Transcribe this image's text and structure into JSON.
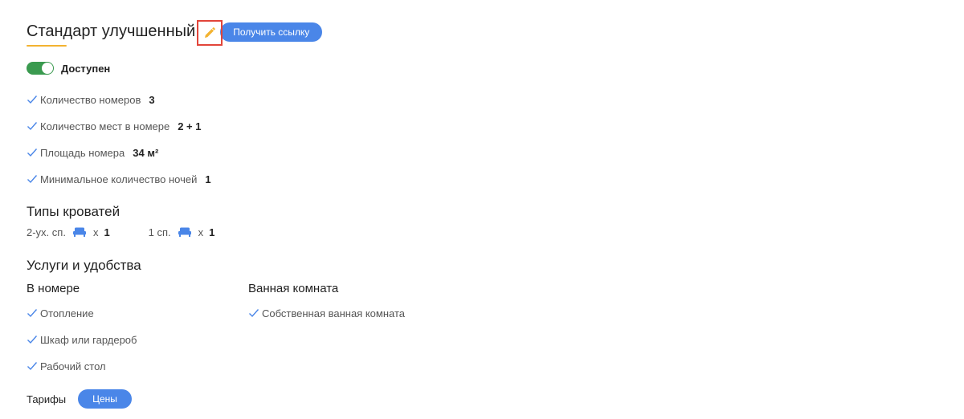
{
  "room": {
    "title": "Стандарт улучшенный",
    "get_link_label": "Получить ссылку",
    "accent_color": "#f3b331",
    "edit_icon": "pencil-icon"
  },
  "availability": {
    "label": "Доступен",
    "enabled": true,
    "toggle_color": "#3a9a4f"
  },
  "features": [
    {
      "label": "Количество номеров",
      "value": "3"
    },
    {
      "label": "Количество мест в номере",
      "value": "2 + 1"
    },
    {
      "label": "Площадь номера",
      "value": "34 м²"
    },
    {
      "label": "Минимальное количество ночей",
      "value": "1"
    }
  ],
  "beds": {
    "title": "Типы кроватей",
    "items": [
      {
        "label": "2-ух. сп.",
        "x": "x",
        "count": "1",
        "icon": "bed-icon"
      },
      {
        "label": "1 сп.",
        "x": "x",
        "count": "1",
        "icon": "bed-icon"
      }
    ]
  },
  "services": {
    "title": "Услуги и удобства",
    "in_room": {
      "title": "В номере",
      "items": [
        "Отопление",
        "Шкаф или гардероб",
        "Рабочий стол"
      ]
    },
    "bathroom": {
      "title": "Ванная комната",
      "items": [
        "Собственная ванная комната"
      ]
    }
  },
  "tariffs": {
    "label": "Тарифы",
    "prices_label": "Цены"
  },
  "colors": {
    "primary": "#4a86e8",
    "check": "#4a86e8",
    "highlight_border": "#e2453a"
  }
}
